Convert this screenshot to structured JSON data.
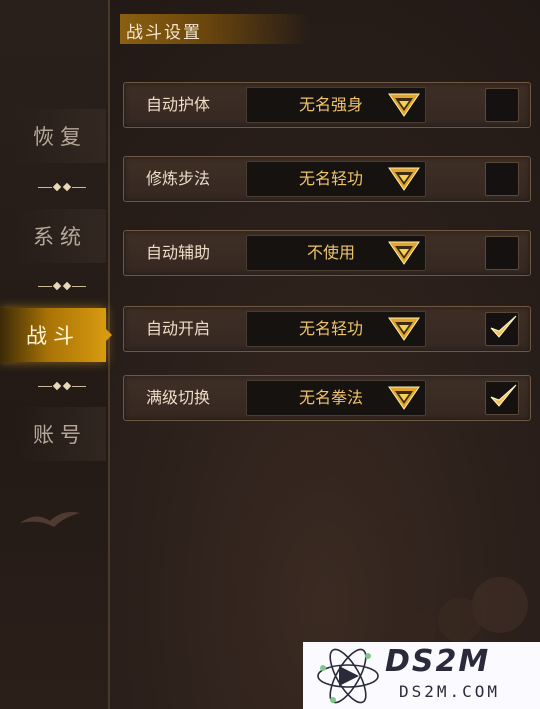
{
  "sidebar": {
    "items": [
      {
        "label": "恢复",
        "active": false
      },
      {
        "label": "系统",
        "active": false
      },
      {
        "label": "战斗",
        "active": true
      },
      {
        "label": "账号",
        "active": false
      }
    ]
  },
  "header": {
    "title": "战斗设置"
  },
  "settings": [
    {
      "label": "自动护体",
      "value": "无名强身",
      "checked": false
    },
    {
      "label": "修炼步法",
      "value": "无名轻功",
      "checked": false
    },
    {
      "label": "自动辅助",
      "value": "不使用",
      "checked": false
    },
    {
      "label": "自动开启",
      "value": "无名轻功",
      "checked": true
    },
    {
      "label": "满级切换",
      "value": "无名拳法",
      "checked": true
    }
  ],
  "watermark": {
    "line1": "DS2M",
    "line2": "DS2M.COM"
  },
  "colors": {
    "accent": "#d89a10",
    "value_text": "#f0c46a",
    "check": "#f3c35c"
  },
  "icons": {
    "dropdown": "chevron-down-icon",
    "check": "check-icon",
    "divider": "diamond-divider-icon"
  }
}
